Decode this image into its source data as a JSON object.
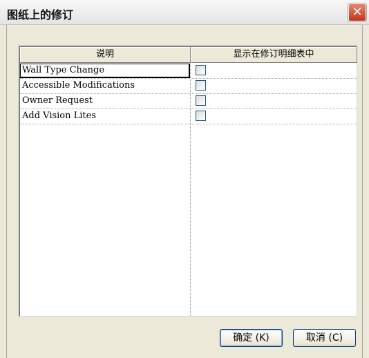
{
  "window": {
    "title": "图纸上的修订",
    "close_glyph": "✕"
  },
  "table": {
    "columns": [
      "说明",
      "显示在修订明细表中"
    ],
    "rows": [
      {
        "description": "Wall Type Change",
        "show_in_schedule": false
      },
      {
        "description": "Accessible Modifications",
        "show_in_schedule": false
      },
      {
        "description": "Owner Request",
        "show_in_schedule": false
      },
      {
        "description": "Add Vision Lites",
        "show_in_schedule": false
      }
    ]
  },
  "buttons": {
    "ok_label": "确定 (K)",
    "cancel_label": "取消 (C)"
  },
  "colors": {
    "dialog_bg": "#ece9d8",
    "close_button": "#c2351c",
    "button_border": "#003c74"
  }
}
